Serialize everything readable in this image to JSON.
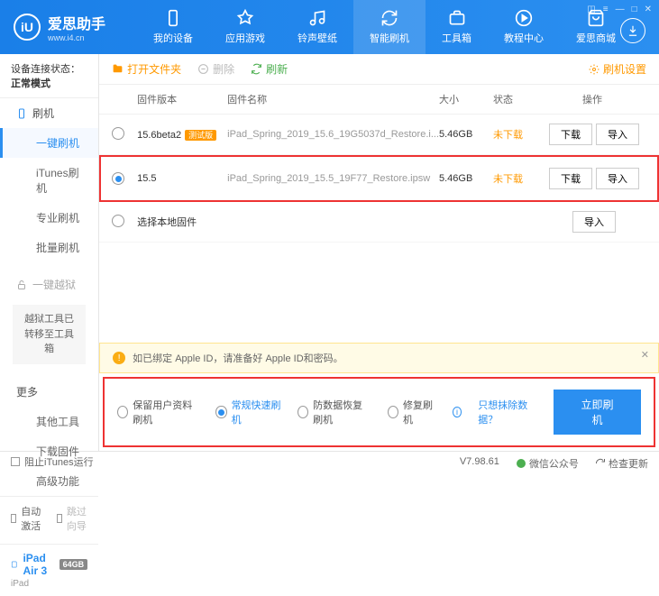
{
  "app": {
    "name": "爱思助手",
    "url": "www.i4.cn"
  },
  "nav": [
    "我的设备",
    "应用游戏",
    "铃声壁纸",
    "智能刷机",
    "工具箱",
    "教程中心",
    "爱思商城"
  ],
  "conn": {
    "label": "设备连接状态：",
    "value": "正常模式"
  },
  "side": {
    "flash": "刷机",
    "items1": [
      "一键刷机",
      "iTunes刷机",
      "专业刷机",
      "批量刷机"
    ],
    "jailbreak": "一键越狱",
    "jbmsg": "越狱工具已转移至工具箱",
    "more": "更多",
    "items2": [
      "其他工具",
      "下载固件",
      "高级功能"
    ],
    "autoAct": "自动激活",
    "skipGuide": "跳过向导"
  },
  "device": {
    "name": "iPad Air 3",
    "storage": "64GB",
    "type": "iPad"
  },
  "toolbar": {
    "open": "打开文件夹",
    "del": "删除",
    "refresh": "刷新",
    "settings": "刷机设置"
  },
  "th": {
    "ver": "固件版本",
    "name": "固件名称",
    "size": "大小",
    "status": "状态",
    "ops": "操作"
  },
  "rows": [
    {
      "ver": "15.6beta2",
      "beta": "测试版",
      "name": "iPad_Spring_2019_15.6_19G5037d_Restore.i...",
      "size": "5.46GB",
      "status": "未下载"
    },
    {
      "ver": "15.5",
      "beta": "",
      "name": "iPad_Spring_2019_15.5_19F77_Restore.ipsw",
      "size": "5.46GB",
      "status": "未下载"
    }
  ],
  "localfw": "选择本地固件",
  "btn": {
    "dl": "下载",
    "imp": "导入"
  },
  "notice": "如已绑定 Apple ID，请准备好 Apple ID和密码。",
  "opts": [
    "保留用户资料刷机",
    "常规快速刷机",
    "防数据恢复刷机",
    "修复刷机"
  ],
  "exclude": "只想抹除数据？",
  "flashNow": "立即刷机",
  "footer": {
    "block": "阻止iTunes运行",
    "ver": "V7.98.61",
    "wechat": "微信公众号",
    "check": "检查更新"
  }
}
